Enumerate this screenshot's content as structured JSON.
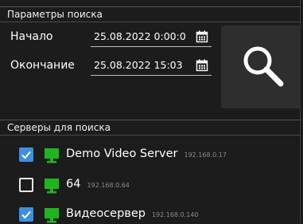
{
  "search_params": {
    "title": "Параметры поиска",
    "start_label": "Начало",
    "start_value": "25.08.2022 0:00:0",
    "end_label": "Окончание",
    "end_value": "25.08.2022 15:03"
  },
  "servers": {
    "title": "Серверы для поиска",
    "items": [
      {
        "name": "Demo Video Server",
        "ip": "192.168.0.17",
        "checked": true
      },
      {
        "name": "64",
        "ip": "192.168.0.64",
        "checked": false
      },
      {
        "name": "Видеосервер",
        "ip": "192.168.0.140",
        "checked": true
      }
    ]
  },
  "colors": {
    "background": "#1c1c1c",
    "accent": "#3d8fe0",
    "server_icon": "#1fb51f"
  },
  "icons": {
    "search": "search-icon",
    "calendar": "calendar-icon",
    "server": "monitor-icon",
    "check": "check-icon"
  }
}
